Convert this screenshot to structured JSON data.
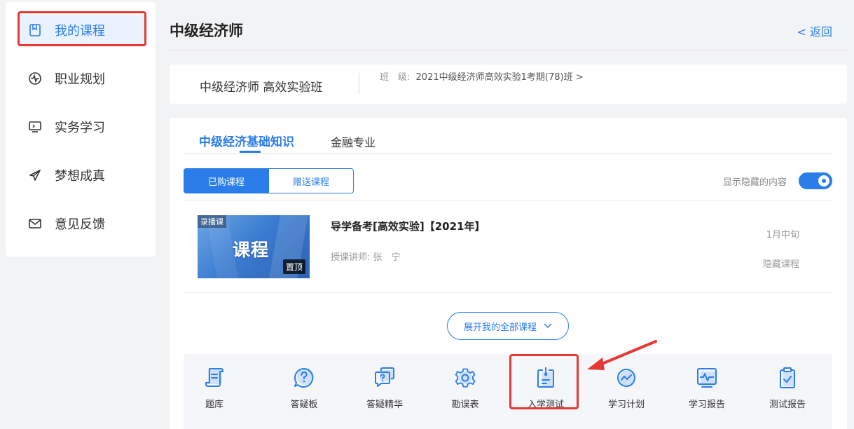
{
  "sidebar": {
    "items": [
      {
        "label": "我的课程",
        "icon": "bookmark-icon",
        "active": true
      },
      {
        "label": "职业规划",
        "icon": "pulse-icon"
      },
      {
        "label": "实务学习",
        "icon": "monitor-icon"
      },
      {
        "label": "梦想成真",
        "icon": "paper-plane-icon"
      },
      {
        "label": "意见反馈",
        "icon": "mail-icon"
      }
    ]
  },
  "header": {
    "title": "中级经济师",
    "back_label": "< 返回"
  },
  "class_card": {
    "name": "中级经济师 高效实验班",
    "class_label": "班　级:",
    "class_value": "2021中级经济师高效实验1考期(78)班 >"
  },
  "tabs": [
    {
      "label": "中级经济基础知识",
      "active": true
    },
    {
      "label": "金融专业"
    }
  ],
  "segments": {
    "purchased": "已购课程",
    "gifted": "赠送课程"
  },
  "toggle": {
    "label": "显示隐藏的内容",
    "on": true
  },
  "course": {
    "thumb_tag": "录播课",
    "thumb_title": "课程",
    "pin_tag": "置顶",
    "title": "导学备考[高效实验]【2021年】",
    "teacher": "授课讲师:  张　宁",
    "date": "1月中旬",
    "hide_label": "隐藏课程"
  },
  "expand_label": "展开我的全部课程",
  "tools": [
    {
      "label": "题库",
      "icon": "scroll-icon"
    },
    {
      "label": "答疑板",
      "icon": "question-bubble-icon"
    },
    {
      "label": "答疑精华",
      "icon": "question-chat-icon"
    },
    {
      "label": "勘误表",
      "icon": "gear-icon"
    },
    {
      "label": "入学测试",
      "icon": "test-clipboard-icon"
    },
    {
      "label": "学习计划",
      "icon": "chart-circle-icon"
    },
    {
      "label": "学习报告",
      "icon": "pulse-report-icon"
    },
    {
      "label": "测试报告",
      "icon": "clipboard-check-icon"
    }
  ],
  "colors": {
    "accent": "#2b7de9",
    "annotation": "#e53935"
  }
}
